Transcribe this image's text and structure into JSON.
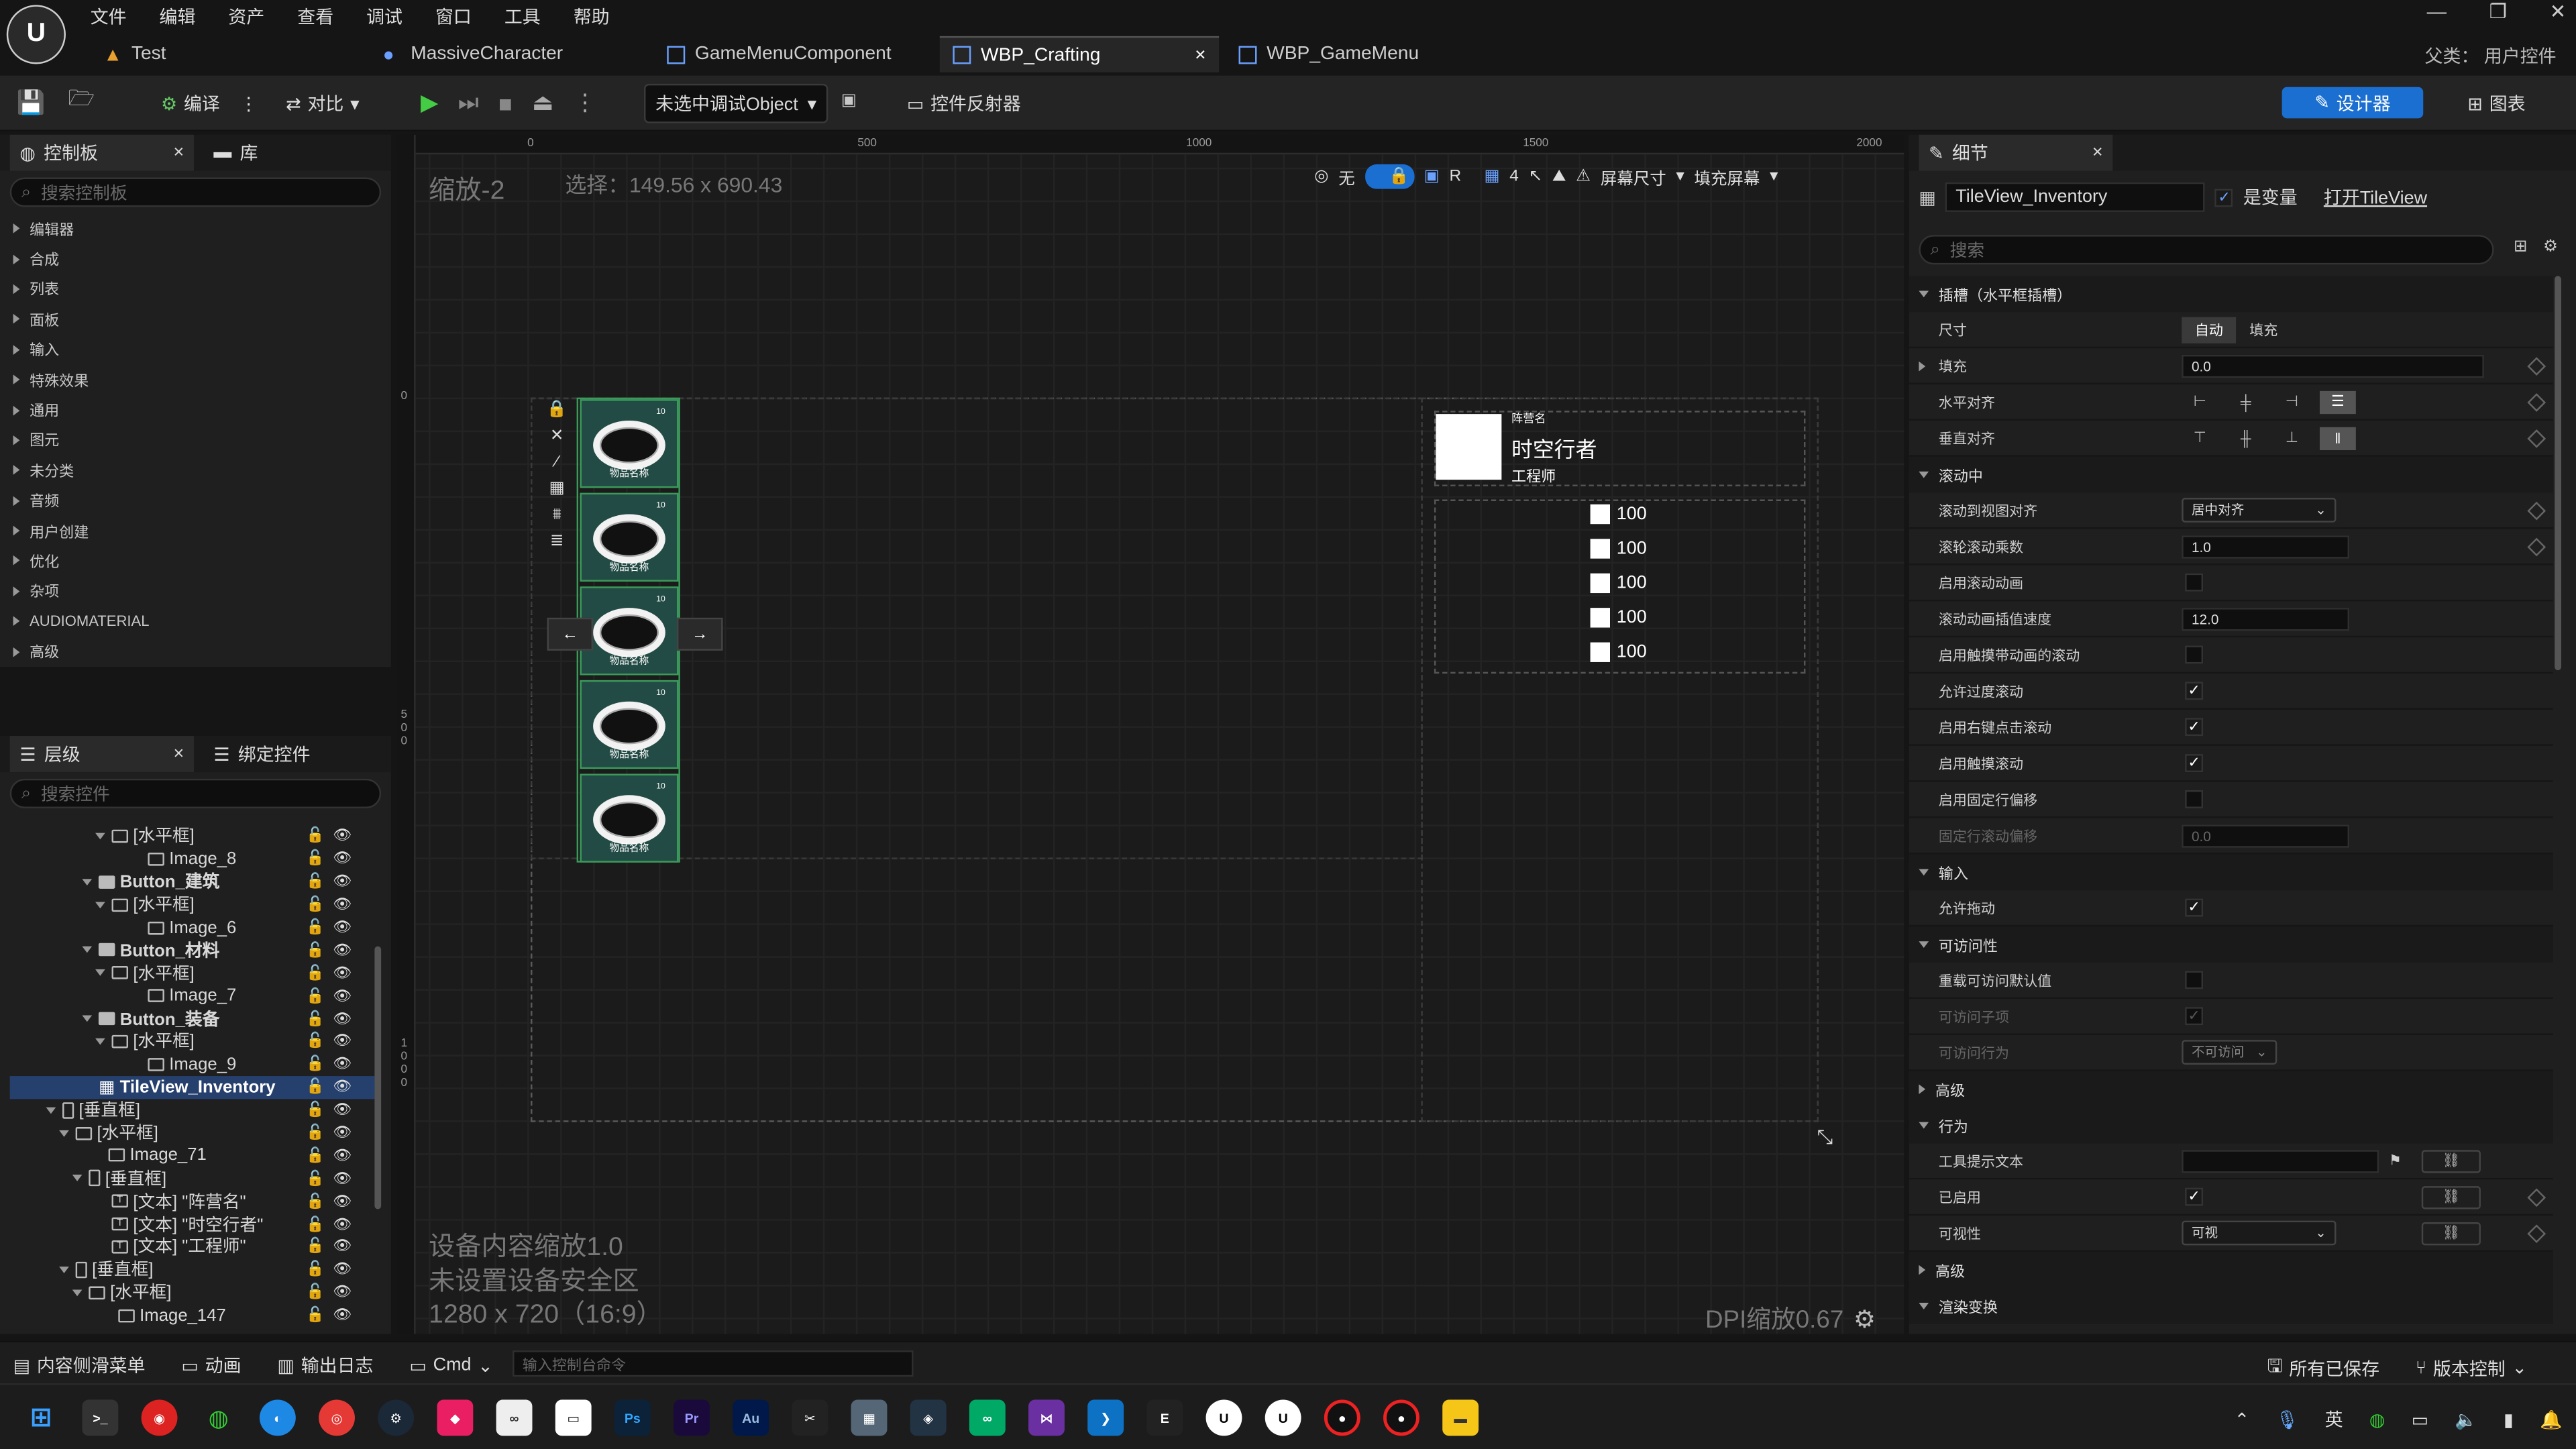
{
  "menu": [
    "文件",
    "编辑",
    "资产",
    "查看",
    "调试",
    "窗口",
    "工具",
    "帮助"
  ],
  "tabs": [
    {
      "label": "Test"
    },
    {
      "label": "MassiveCharacter"
    },
    {
      "label": "GameMenuComponent"
    },
    {
      "label": "WBP_Crafting"
    },
    {
      "label": "WBP_GameMenu"
    }
  ],
  "parent_class": "父类： 用户控件",
  "toolbar": {
    "compile": "编译",
    "diff": "对比",
    "debug_object": "未选中调试Object",
    "reflector": "控件反射器",
    "designer": "设计器",
    "graph": "图表"
  },
  "palette": {
    "title": "控制板",
    "library": "库",
    "search_placeholder": "搜索控制板",
    "categories": [
      "编辑器",
      "合成",
      "列表",
      "面板",
      "输入",
      "特殊效果",
      "通用",
      "图元",
      "未分类",
      "音频",
      "用户创建",
      "优化",
      "杂项",
      "AUDIOMATERIAL",
      "高级"
    ]
  },
  "hierarchy": {
    "title": "层级",
    "bind": "绑定控件",
    "search_placeholder": "搜索控件",
    "rows": [
      "[水平框]",
      "Image_8",
      "Button_建筑",
      "[水平框]",
      "Image_6",
      "Button_材料",
      "[水平框]",
      "Image_7",
      "Button_装备",
      "[水平框]",
      "Image_9",
      "TileView_Inventory",
      "[垂直框]",
      "[水平框]",
      "Image_71",
      "[垂直框]",
      "[文本] \"阵营名\"",
      "[文本] \"时空行者\"",
      "[文本] \"工程师\"",
      "[垂直框]",
      "[水平框]",
      "Image_147"
    ]
  },
  "canvas": {
    "zoom": "缩放-2",
    "selection": "选择：149.56 x 690.43",
    "ruler": [
      "0",
      "500",
      "1000",
      "1500",
      "2000"
    ],
    "ruler_v": [
      "0",
      "5 0 0",
      "1 0 0 0"
    ],
    "toolbar": {
      "none": "无",
      "r": "R",
      "grid": "4",
      "screen_size": "屏幕尺寸",
      "fill_screen": "填充屏幕"
    },
    "item_name": "物品名称",
    "item_count": "10",
    "faction_label": "阵营名",
    "faction_name": "时空行者",
    "faction_role": "工程师",
    "stats": [
      "100",
      "100",
      "100",
      "100",
      "100"
    ],
    "arrow_left": "←",
    "arrow_right": "→",
    "device_scale": "设备内容缩放1.0",
    "safe_zone": "未设置设备安全区",
    "resolution": "1280 x 720（16:9）",
    "dpi": "DPI缩放0.67"
  },
  "details": {
    "title": "细节",
    "name": "TileView_Inventory",
    "is_variable": "是变量",
    "open": "打开TileView",
    "search_placeholder": "搜索",
    "slot_section": "插槽（水平框插槽）",
    "size": "尺寸",
    "size_auto": "自动",
    "size_fill": "填充",
    "fill": "填充",
    "fill_value": "0.0",
    "halign": "水平对齐",
    "valign": "垂直对齐",
    "scroll_section": "滚动中",
    "scroll_align": "滚动到视图对齐",
    "scroll_align_value": "居中对齐",
    "wheel_mult": "滚轮滚动乘数",
    "wheel_mult_value": "1.0",
    "enable_anim": "启用滚动动画",
    "anim_speed": "滚动动画插值速度",
    "anim_speed_value": "12.0",
    "touch_anim": "启用触摸带动画的滚动",
    "overscroll": "允许过度滚动",
    "right_click": "启用右键点击滚动",
    "touch_scroll": "启用触摸滚动",
    "fixed_offset": "启用固定行偏移",
    "fixed_offset_val_label": "固定行滚动偏移",
    "fixed_offset_val": "0.0",
    "input_section": "输入",
    "allow_drag": "允许拖动",
    "access_section": "可访问性",
    "override_access": "重载可访问默认值",
    "access_children": "可访问子项",
    "access_behavior": "可访问行为",
    "access_behavior_value": "不可访问",
    "advanced": "高级",
    "behavior_section": "行为",
    "tooltip": "工具提示文本",
    "enabled": "已启用",
    "visibility": "可视性",
    "visibility_value": "可视",
    "advanced2": "高级",
    "render_section": "渲染变换"
  },
  "status": {
    "content_drawer": "内容侧滑菜单",
    "anim": "动画",
    "output_log": "输出日志",
    "cmd": "Cmd",
    "cmd_placeholder": "输入控制台命令",
    "saved": "所有已保存",
    "version": "版本控制"
  },
  "taskbar": {
    "ime": "英",
    "ps": "Ps",
    "pr": "Pr",
    "au": "Au"
  },
  "colors": {
    "accent": "#1a6fd0",
    "slot_bg": "#234b45",
    "slot_border": "#3b9a5a"
  }
}
